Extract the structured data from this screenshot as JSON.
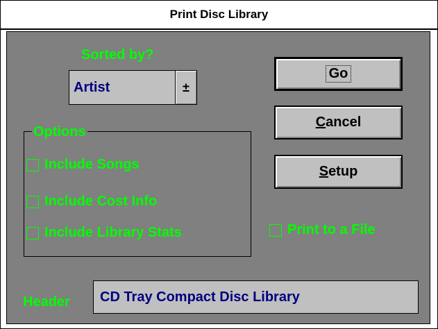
{
  "window": {
    "title": "Print Disc Library"
  },
  "sort": {
    "label": "Sorted by?",
    "selected": "Artist",
    "arrow_glyph": "±"
  },
  "options": {
    "title": "Options",
    "items": [
      {
        "label": "Include Songs",
        "checked": false
      },
      {
        "label": "Include Cost Info",
        "checked": false
      },
      {
        "label": "Include Library Stats",
        "checked": false
      }
    ]
  },
  "buttons": {
    "go": {
      "label": "Go"
    },
    "cancel": {
      "label_accel": "C",
      "label_rest": "ancel"
    },
    "setup": {
      "label_accel": "S",
      "label_rest": "etup"
    }
  },
  "print_to_file": {
    "label": "Print to a File",
    "checked": false
  },
  "header": {
    "label": "Header",
    "value": "CD Tray Compact Disc Library"
  },
  "colors": {
    "accent_text": "#00ff00",
    "field_text": "#000080",
    "client_bg": "#808080",
    "control_bg": "#c0c0c0"
  }
}
